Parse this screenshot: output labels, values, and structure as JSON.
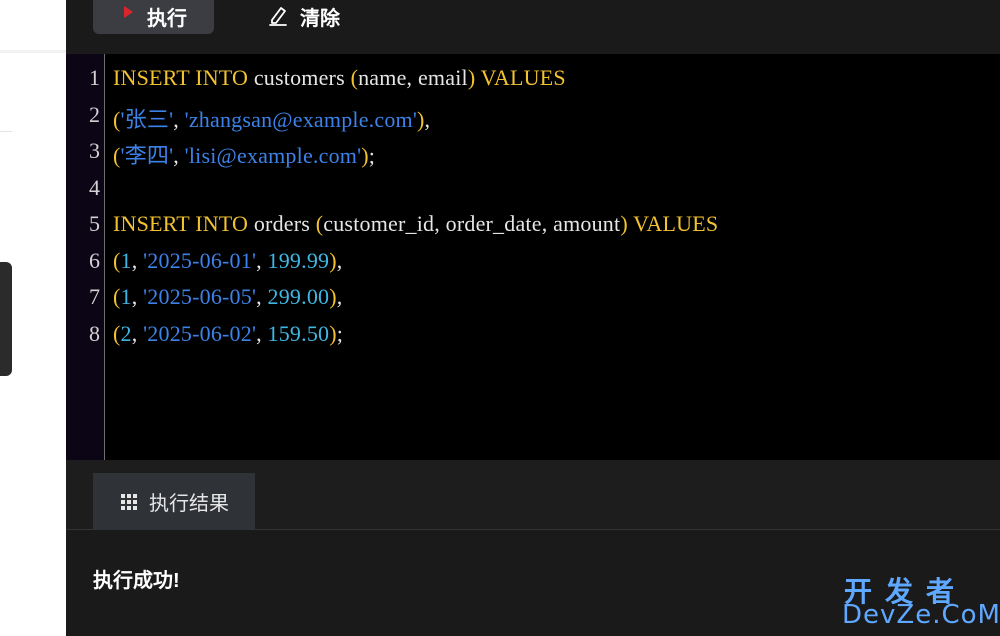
{
  "toolbar": {
    "run_label": "执行",
    "clear_label": "清除",
    "run_icon": "play-icon",
    "clear_icon": "eraser-icon"
  },
  "editor": {
    "line_numbers": [
      "1",
      "2",
      "3",
      "4",
      "5",
      "6",
      "7",
      "8"
    ],
    "lines": [
      [
        {
          "t": "INSERT",
          "c": "t-kw"
        },
        {
          "t": " ",
          "c": "t-sep"
        },
        {
          "t": "INTO",
          "c": "t-kw"
        },
        {
          "t": " ",
          "c": "t-sep"
        },
        {
          "t": "customers",
          "c": "t-id"
        },
        {
          "t": " ",
          "c": "t-sep"
        },
        {
          "t": "(",
          "c": "t-pun"
        },
        {
          "t": "name",
          "c": "t-id"
        },
        {
          "t": ", ",
          "c": "t-sep"
        },
        {
          "t": "email",
          "c": "t-id"
        },
        {
          "t": ")",
          "c": "t-pun"
        },
        {
          "t": " ",
          "c": "t-sep"
        },
        {
          "t": "VALUES",
          "c": "t-kw"
        }
      ],
      [
        {
          "t": "(",
          "c": "t-pun"
        },
        {
          "t": "'张三'",
          "c": "t-str"
        },
        {
          "t": ", ",
          "c": "t-sep"
        },
        {
          "t": "'zhangsan@example.com'",
          "c": "t-str"
        },
        {
          "t": ")",
          "c": "t-pun"
        },
        {
          "t": ",",
          "c": "t-sep"
        }
      ],
      [
        {
          "t": "(",
          "c": "t-pun"
        },
        {
          "t": "'李四'",
          "c": "t-str"
        },
        {
          "t": ", ",
          "c": "t-sep"
        },
        {
          "t": "'lisi@example.com'",
          "c": "t-str"
        },
        {
          "t": ")",
          "c": "t-pun"
        },
        {
          "t": ";",
          "c": "t-sep"
        }
      ],
      [],
      [
        {
          "t": "INSERT",
          "c": "t-kw"
        },
        {
          "t": " ",
          "c": "t-sep"
        },
        {
          "t": "INTO",
          "c": "t-kw"
        },
        {
          "t": " ",
          "c": "t-sep"
        },
        {
          "t": "orders",
          "c": "t-id"
        },
        {
          "t": " ",
          "c": "t-sep"
        },
        {
          "t": "(",
          "c": "t-pun"
        },
        {
          "t": "customer_id",
          "c": "t-id"
        },
        {
          "t": ", ",
          "c": "t-sep"
        },
        {
          "t": "order_date",
          "c": "t-id"
        },
        {
          "t": ", ",
          "c": "t-sep"
        },
        {
          "t": "amount",
          "c": "t-id"
        },
        {
          "t": ")",
          "c": "t-pun"
        },
        {
          "t": " ",
          "c": "t-sep"
        },
        {
          "t": "VALUES",
          "c": "t-kw"
        }
      ],
      [
        {
          "t": "(",
          "c": "t-pun"
        },
        {
          "t": "1",
          "c": "t-num"
        },
        {
          "t": ", ",
          "c": "t-sep"
        },
        {
          "t": "'2025-06-01'",
          "c": "t-str"
        },
        {
          "t": ", ",
          "c": "t-sep"
        },
        {
          "t": "199.99",
          "c": "t-num"
        },
        {
          "t": ")",
          "c": "t-pun"
        },
        {
          "t": ",",
          "c": "t-sep"
        }
      ],
      [
        {
          "t": "(",
          "c": "t-pun"
        },
        {
          "t": "1",
          "c": "t-num"
        },
        {
          "t": ", ",
          "c": "t-sep"
        },
        {
          "t": "'2025-06-05'",
          "c": "t-str"
        },
        {
          "t": ", ",
          "c": "t-sep"
        },
        {
          "t": "299.00",
          "c": "t-num"
        },
        {
          "t": ")",
          "c": "t-pun"
        },
        {
          "t": ",",
          "c": "t-sep"
        }
      ],
      [
        {
          "t": "(",
          "c": "t-pun"
        },
        {
          "t": "2",
          "c": "t-num"
        },
        {
          "t": ", ",
          "c": "t-sep"
        },
        {
          "t": "'2025-06-02'",
          "c": "t-str"
        },
        {
          "t": ", ",
          "c": "t-sep"
        },
        {
          "t": "159.50",
          "c": "t-num"
        },
        {
          "t": ")",
          "c": "t-pun"
        },
        {
          "t": ";",
          "c": "t-sep"
        }
      ]
    ]
  },
  "results": {
    "tab_label": "执行结果",
    "tab_icon": "grid-icon",
    "output_text": "执行成功!"
  },
  "watermark": {
    "line1": "开发者",
    "line2": "DevZe.CoM"
  },
  "colors": {
    "keyword": "#f2c230",
    "string": "#3d82e8",
    "number": "#3fb7e3",
    "identifier": "#e6e6e6",
    "run_icon": "#d9262c",
    "watermark": "#5fa8ff"
  }
}
